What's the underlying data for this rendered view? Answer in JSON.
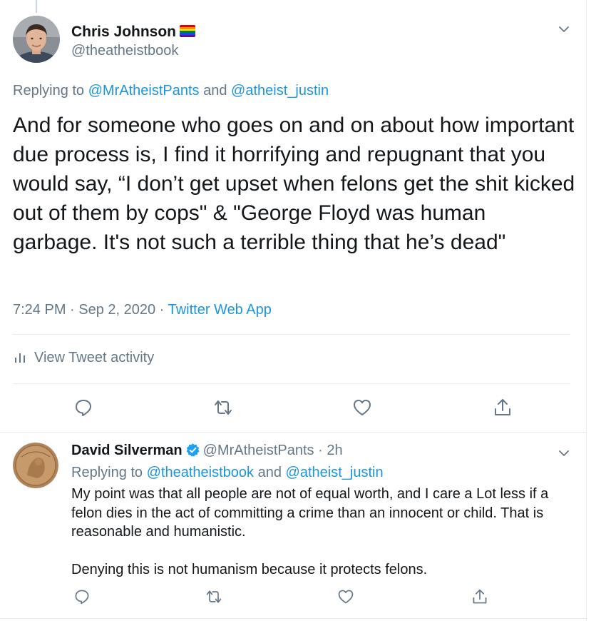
{
  "main_tweet": {
    "author_name": "Chris Johnson",
    "author_handle": "@theatheistbook",
    "name_emoji": "rainbow-flag",
    "replying_prefix": "Replying to",
    "replying_handle_1": "@MrAtheistPants",
    "replying_and": "and",
    "replying_handle_2": "@atheist_justin",
    "text": "And for someone who goes on and on about how important due process is, I find it horrifying and repugnant that you would say, “I don’t get upset when felons get the shit kicked out of them by cops\" & \"George Floyd was human garbage. It's not such a terrible thing that he’s dead\"",
    "time": "7:24 PM",
    "dot": "·",
    "date": "Sep 2, 2020",
    "source": "Twitter Web App",
    "activity_label": "View Tweet activity",
    "actions": [
      "reply-icon",
      "retweet-icon",
      "like-icon",
      "share-icon"
    ]
  },
  "reply_tweet": {
    "author_name": "David Silverman",
    "verified": true,
    "author_handle": "@MrAtheistPants",
    "dot": "·",
    "time_ago": "2h",
    "replying_prefix": "Replying to",
    "replying_handle_1": "@theatheistbook",
    "replying_and": "and",
    "replying_handle_2": "@atheist_justin",
    "paragraph_1": "My point was that all people are not of equal worth, and I care a Lot  less if a felon dies in the act of committing a crime than an innocent or child. That is reasonable and humanistic.",
    "paragraph_2": "Denying this is not humanism because it protects felons.",
    "actions": [
      "reply-icon",
      "retweet-icon",
      "like-icon",
      "share-icon"
    ]
  },
  "colors": {
    "text": "#14171a",
    "secondary": "#657786",
    "link": "#1b95e0",
    "divider": "#e6ecf0",
    "verified": "#1da1f2"
  }
}
